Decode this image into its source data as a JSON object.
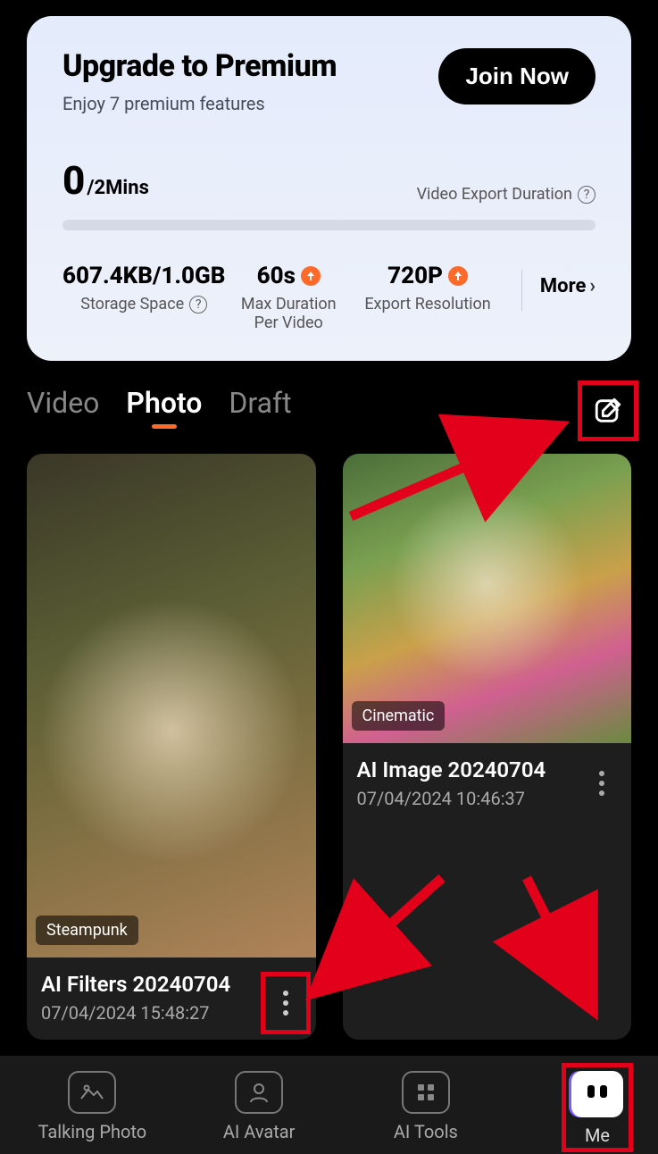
{
  "premium": {
    "title": "Upgrade to Premium",
    "subtitle": "Enjoy 7 premium features",
    "join": "Join Now",
    "used": "0",
    "limit": "/2Mins",
    "export_label": "Video Export Duration",
    "stats": {
      "storage": {
        "value": "607.4KB/1.0GB",
        "label": "Storage Space"
      },
      "duration": {
        "value": "60s",
        "label1": "Max Duration",
        "label2": "Per Video"
      },
      "resolution": {
        "value": "720P",
        "label": "Export Resolution"
      }
    },
    "more": "More"
  },
  "tabs": {
    "video": "Video",
    "photo": "Photo",
    "draft": "Draft"
  },
  "cards": [
    {
      "badge": "Steampunk",
      "title": "AI Filters 20240704",
      "date": "07/04/2024 15:48:27"
    },
    {
      "badge": "Cinematic",
      "title": "AI Image 20240704",
      "date": "07/04/2024 10:46:37"
    }
  ],
  "nav": {
    "talking_photo": "Talking Photo",
    "ai_avatar": "AI Avatar",
    "ai_tools": "AI Tools",
    "me": "Me"
  }
}
